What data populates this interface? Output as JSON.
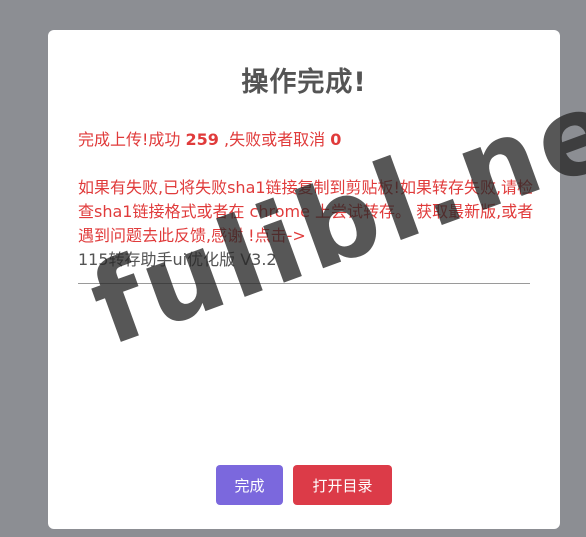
{
  "dialog": {
    "title": "操作完成!",
    "stats": {
      "prefix": "完成上传!成功",
      "success_count": "259",
      "middle": ",失败或者取消",
      "fail_count": "0"
    },
    "notice": "如果有失败,已将失败sha1链接复制到剪贴板!如果转存失败,请检查sha1链接格式或者在 chrome 上尝试转存。 获取最新版,或者遇到问题去此反馈,感谢 !点击->",
    "link": "115转存助手ui优化版 V3.2",
    "buttons": {
      "ok": "完成",
      "open_dir": "打开目录"
    }
  },
  "watermark": "fulibl.net",
  "colors": {
    "overlay": "#8c8e93",
    "error_text": "#e03b3b",
    "ok_button": "#7b68dd",
    "open_button": "#dc3b48"
  }
}
